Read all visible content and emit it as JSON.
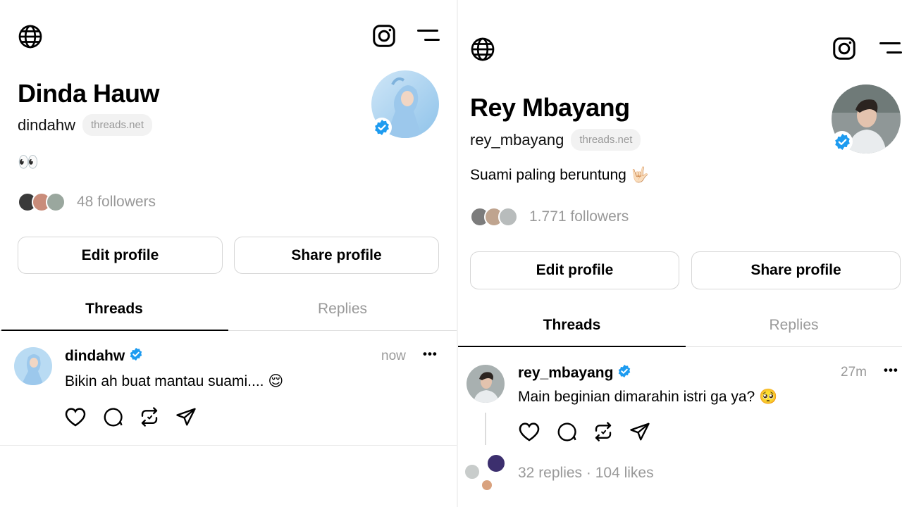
{
  "profiles": [
    {
      "name": "Dinda Hauw",
      "handle": "dindahw",
      "domain": "threads.net",
      "bio": "👀",
      "followers": "48 followers",
      "edit_label": "Edit profile",
      "share_label": "Share profile",
      "tabs": [
        "Threads",
        "Replies"
      ],
      "post": {
        "user": "dindahw",
        "time": "now",
        "more": "•••",
        "text": "Bikin ah buat mantau suami.... 😌"
      }
    },
    {
      "name": "Rey Mbayang",
      "handle": "rey_mbayang",
      "domain": "threads.net",
      "bio": "Suami paling beruntung 🤟🏻",
      "followers": "1.771 followers",
      "edit_label": "Edit profile",
      "share_label": "Share profile",
      "tabs": [
        "Threads",
        "Replies"
      ],
      "post": {
        "user": "rey_mbayang",
        "time": "27m",
        "more": "•••",
        "text": "Main beginian dimarahin istri ga ya? 🥺",
        "stats": "32 replies · 104 likes"
      }
    }
  ],
  "colors": {
    "verified": "#1d9bf0",
    "muted": "#999999",
    "border": "#d6d6d6"
  },
  "icons": [
    "globe-icon",
    "instagram-icon",
    "menu-icon",
    "verified-icon",
    "heart-icon",
    "comment-icon",
    "repost-icon",
    "share-icon",
    "more-icon"
  ]
}
